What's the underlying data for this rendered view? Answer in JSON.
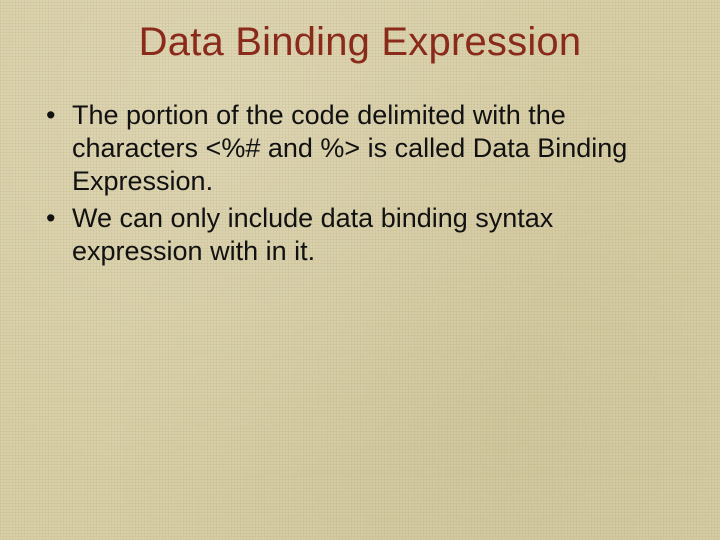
{
  "slide": {
    "title": "Data Binding Expression",
    "bullets": [
      "The portion of the code delimited with the characters <%# and %> is called Data Binding Expression.",
      "We can only include data binding syntax expression with in it."
    ]
  }
}
